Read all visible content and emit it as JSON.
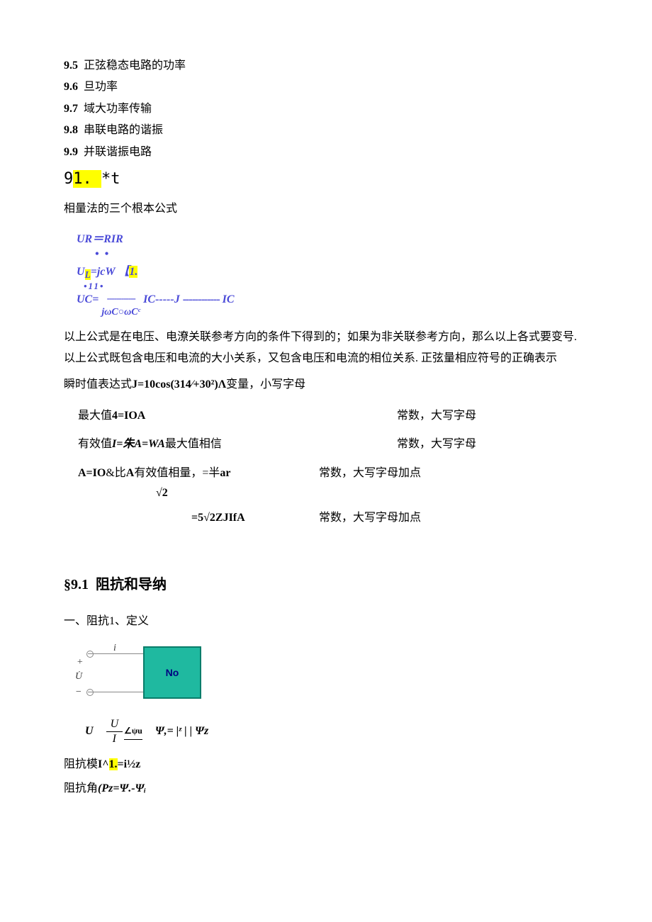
{
  "toc": [
    {
      "num": "9.5",
      "title": "正弦稳态电路的功率"
    },
    {
      "num": "9.6",
      "title": "旦功率"
    },
    {
      "num": "9.7",
      "title": "域大功率传输"
    },
    {
      "num": "9.8",
      "title": "串联电路的谐振"
    },
    {
      "num": "9.9",
      "title": "并联谐振电路"
    }
  ],
  "marker91": {
    "a": "9",
    "b": "1. ",
    "c": "*t"
  },
  "intro": "相量法的三个根本公式",
  "formula": {
    "ur": "UR＝RIR",
    "dots1": "• •",
    "ul_a": "U",
    "ul_sub": "L",
    "ul_b": "=jcW 【",
    "ul_hl": "1.",
    "dots2": "•11•",
    "uc_a": "UC= ",
    "uc_dash1": "------------",
    "uc_mid": "IC-----J ",
    "uc_dash2": "------------",
    "uc_end": "IC",
    "uc_den": "jωC○ωCᶜ"
  },
  "para1": "以上公式是在电压、电潦关联参考方向的条件下得到的；如果为非关联参考方向，那么以上各式要变号. 以上公式既包含电压和电流的大小关系，又包含电压和电流的相位关系. 正弦量相应符号的正确表示",
  "para2_a": "瞬时值表达式",
  "para2_b": "J=10cos(314∕+30²)Λ",
  "para2_c": "变量，小写字母",
  "rows": [
    {
      "left": "最大值4=IOA",
      "right": "常数，大写字母"
    },
    {
      "left_a": "有效值",
      "left_b": "I=朱A=WA",
      "left_c": "最大值相信",
      "right": "常数，大写字母"
    }
  ],
  "row3": {
    "left_a": "A=IO",
    "left_b": "&比",
    "left_c": "A",
    "left_d": "有效值相量，=半",
    "left_e": "ar",
    "right": "常数，大写字母加点"
  },
  "sqrt2": "√2",
  "row4": {
    "eq": "=5√2ZJIfA",
    "right": "常数，大写字母加点"
  },
  "section": {
    "num": "§9.1",
    "title": "阻抗和导纳"
  },
  "sub1": "一、阻抗1、定义",
  "diagram": {
    "i": "i",
    "plus": "+",
    "u": "U",
    "minus": "−",
    "box": "No",
    "udot": "U̇"
  },
  "after": {
    "U": "U",
    "frac_top": "U",
    "frac_bot": "I",
    "ang": "∠ψu",
    "psi": "Ψ,= |ᶻ | | Ψz"
  },
  "line_a1": "阻抗模",
  "line_a2": "I^",
  "line_a_hl": "1.",
  "line_a3": "=i½z",
  "line_b1": "阻抗角",
  "line_b2": "(Pz=Ψ.-Ψᵢ"
}
